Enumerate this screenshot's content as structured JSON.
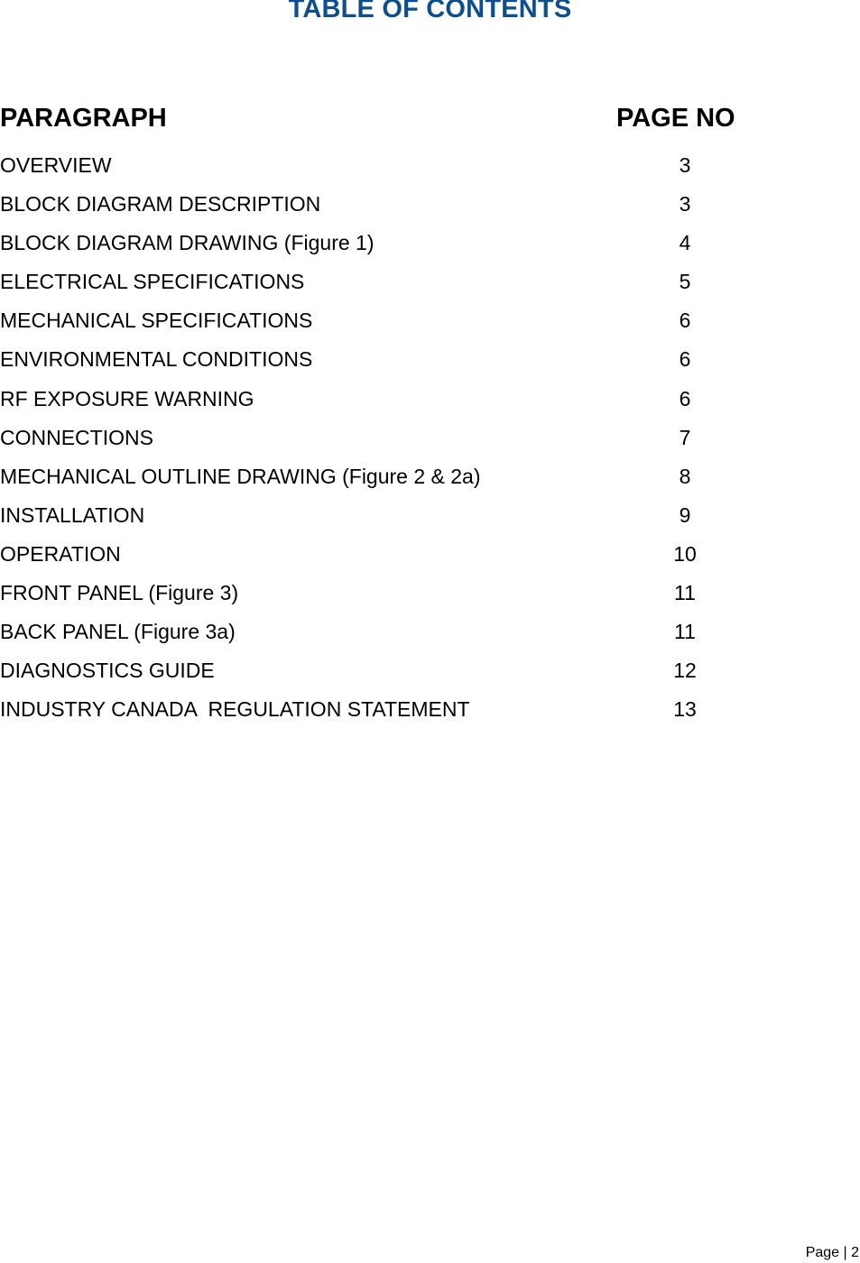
{
  "document": {
    "title": "TABLE OF CONTENTS",
    "title_color": "#0b4f91"
  },
  "headers": {
    "paragraph": "PARAGRAPH",
    "page_no": "PAGE NO"
  },
  "entries": [
    {
      "label": "OVERVIEW",
      "page": "3"
    },
    {
      "label": "BLOCK DIAGRAM DESCRIPTION",
      "page": "3"
    },
    {
      "label": "BLOCK DIAGRAM DRAWING (Figure 1)",
      "page": "4"
    },
    {
      "label": "ELECTRICAL SPECIFICATIONS",
      "page": "5"
    },
    {
      "label": "MECHANICAL SPECIFICATIONS",
      "page": "6"
    },
    {
      "label": "ENVIRONMENTAL CONDITIONS",
      "page": "6"
    },
    {
      "label": "RF EXPOSURE WARNING",
      "page": "6"
    },
    {
      "label": "CONNECTIONS",
      "page": "7"
    },
    {
      "label": "MECHANICAL OUTLINE DRAWING (Figure 2 & 2a)",
      "page": "8"
    },
    {
      "label": "INSTALLATION",
      "page": "9"
    },
    {
      "label": "OPERATION",
      "page": "10"
    },
    {
      "label": "FRONT PANEL (Figure 3)",
      "page": "11"
    },
    {
      "label": "BACK PANEL (Figure 3a)",
      "page": "11"
    },
    {
      "label": "DIAGNOSTICS GUIDE",
      "page": "12"
    },
    {
      "label": "INDUSTRY CANADA  REGULATION STATEMENT",
      "page": "13"
    }
  ],
  "footer": {
    "page_label": "Page | 2"
  }
}
